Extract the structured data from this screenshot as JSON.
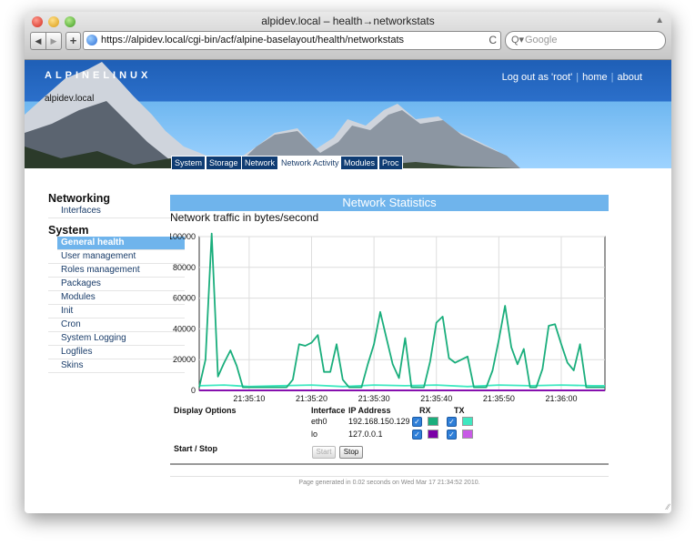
{
  "browser": {
    "title": "alpidev.local – health→networkstats",
    "url": "https://alpidev.local/cgi-bin/acf/alpine-baselayout/health/networkstats",
    "search_placeholder": "Google",
    "back_icon": "◀",
    "forward_icon": "▶",
    "add_icon": "+",
    "reload_icon": "C",
    "search_icon": "Q▾",
    "lock_icon": "▲",
    "resize_grip": "∕∕"
  },
  "header": {
    "logo": "ALPINELINUX",
    "hostname": "alpidev.local",
    "links": {
      "logout": "Log out as 'root'",
      "home": "home",
      "about": "about",
      "sep": "|"
    }
  },
  "tabs": [
    {
      "label": "System",
      "active": false
    },
    {
      "label": "Storage",
      "active": false
    },
    {
      "label": "Network",
      "active": false
    },
    {
      "label": "Network Activity",
      "active": true
    },
    {
      "label": "Modules",
      "active": false
    },
    {
      "label": "Proc",
      "active": false
    }
  ],
  "sidebar": {
    "sections": [
      {
        "title": "Networking",
        "items": [
          "Interfaces"
        ]
      },
      {
        "title": "System",
        "items": [
          "General health",
          "User management",
          "Roles management",
          "Packages",
          "Modules",
          "Init",
          "Cron",
          "System Logging",
          "Logfiles",
          "Skins"
        ]
      }
    ],
    "selected": "General health"
  },
  "main": {
    "section_title": "Network Statistics",
    "subtitle": "Network traffic in bytes/second",
    "display_options_label": "Display Options",
    "start_stop_label": "Start / Stop",
    "columns": {
      "interface": "Interface",
      "ip": "IP Address",
      "rx": "RX",
      "tx": "TX"
    },
    "interfaces": [
      {
        "name": "eth0",
        "ip": "192.168.150.129",
        "rx_checked": true,
        "tx_checked": true,
        "rx_color": "#1aae7c",
        "tx_color": "#3ee8c0"
      },
      {
        "name": "lo",
        "ip": "127.0.0.1",
        "rx_checked": true,
        "tx_checked": true,
        "rx_color": "#7b00a6",
        "tx_color": "#c85ae6"
      }
    ],
    "checkmark": "✓",
    "start_label": "Start",
    "stop_label": "Stop",
    "start_disabled": true
  },
  "footer": {
    "text": "Page generated in 0.02 seconds on Wed Mar 17 21:34:52 2010."
  },
  "chart_data": {
    "type": "line",
    "title": "",
    "xlabel": "",
    "ylabel": "",
    "ylim": [
      0,
      100000
    ],
    "yticks": [
      0,
      20000,
      40000,
      60000,
      80000,
      100000
    ],
    "x_tick_labels": [
      "21:35:10",
      "21:35:20",
      "21:35:30",
      "21:35:40",
      "21:35:50",
      "21:36:00"
    ],
    "x_tick_seconds": [
      10,
      20,
      30,
      40,
      50,
      60
    ],
    "xlim_seconds": [
      2,
      67
    ],
    "grid": true,
    "series": [
      {
        "name": "eth0 RX",
        "color": "#1aae7c",
        "x_seconds": [
          2,
          3,
          4,
          5,
          6,
          7,
          8,
          9,
          10,
          11,
          12,
          13,
          14,
          15,
          16,
          17,
          18,
          19,
          20,
          21,
          22,
          23,
          24,
          25,
          26,
          27,
          28,
          29,
          30,
          31,
          32,
          33,
          34,
          35,
          36,
          37,
          38,
          39,
          40,
          41,
          42,
          43,
          44,
          45,
          46,
          47,
          48,
          49,
          50,
          51,
          52,
          53,
          54,
          55,
          56,
          57,
          58,
          59,
          60,
          61,
          62,
          63,
          64,
          65,
          66,
          67
        ],
        "values": [
          2000,
          20000,
          102000,
          9000,
          18000,
          26000,
          16000,
          2000,
          2000,
          2000,
          2000,
          2000,
          2000,
          2000,
          2000,
          7000,
          30000,
          29000,
          31000,
          36000,
          12000,
          12000,
          30000,
          7000,
          2000,
          2000,
          2000,
          17000,
          30000,
          51000,
          34000,
          17000,
          8000,
          34000,
          2000,
          2000,
          2000,
          19000,
          44000,
          48000,
          21000,
          18000,
          20000,
          22000,
          2000,
          2000,
          2000,
          13000,
          33000,
          55000,
          28000,
          17000,
          27000,
          2000,
          2000,
          14000,
          42000,
          43000,
          30000,
          18000,
          13000,
          30000,
          2000,
          2000,
          2000,
          2000
        ]
      },
      {
        "name": "eth0 TX",
        "color": "#3ee8c0",
        "x_seconds": [
          2,
          6,
          10,
          15,
          20,
          25,
          30,
          35,
          40,
          45,
          50,
          55,
          60,
          65,
          67
        ],
        "values": [
          3000,
          3500,
          2500,
          3000,
          3500,
          2500,
          3500,
          3000,
          3500,
          2500,
          3500,
          3000,
          3500,
          3000,
          3000
        ]
      },
      {
        "name": "lo RX",
        "color": "#7b00a6",
        "x_seconds": [
          2,
          67
        ],
        "values": [
          0,
          0
        ]
      },
      {
        "name": "lo TX",
        "color": "#c85ae6",
        "x_seconds": [
          2,
          67
        ],
        "values": [
          0,
          0
        ]
      }
    ]
  }
}
